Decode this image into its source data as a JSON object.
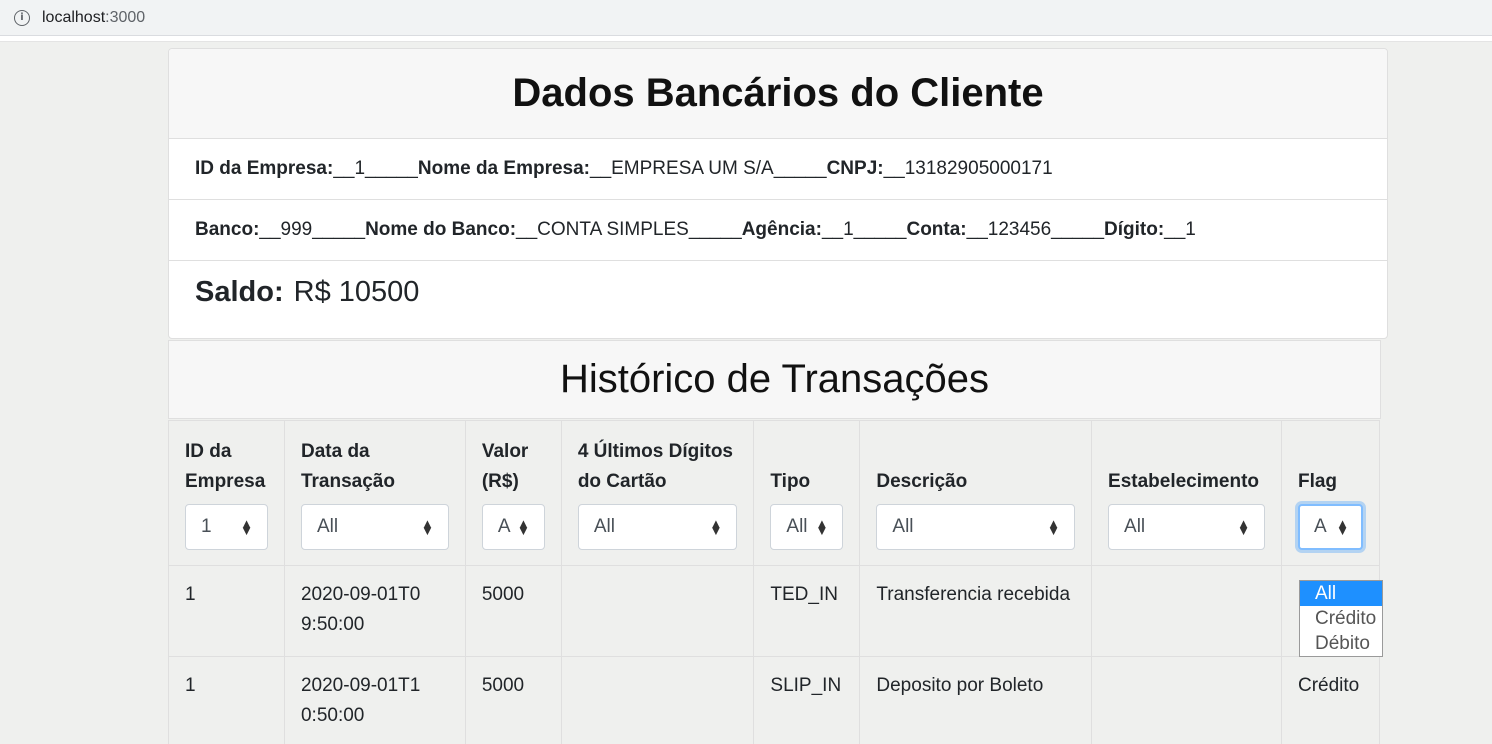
{
  "browser": {
    "host": "localhost",
    "port": ":3000"
  },
  "card": {
    "title": "Dados Bancários do Cliente",
    "row1": {
      "id_label": "ID da Empresa:",
      "id_value": "__1_____",
      "nome_label": "Nome da Empresa:",
      "nome_value": "__EMPRESA UM S/A_____",
      "cnpj_label": "CNPJ:",
      "cnpj_value": "__13182905000171"
    },
    "row2": {
      "banco_label": "Banco:",
      "banco_value": "__999_____",
      "nome_banco_label": "Nome do Banco:",
      "nome_banco_value": "__CONTA SIMPLES_____",
      "agencia_label": "Agência:",
      "agencia_value": "__1_____",
      "conta_label": "Conta:",
      "conta_value": "__123456_____",
      "digito_label": "Dígito:",
      "digito_value": "__1"
    },
    "saldo_label": "Saldo:",
    "saldo_value": "R$ 10500"
  },
  "history": {
    "title": "Histórico de Transações",
    "columns": [
      {
        "label": "ID da Empresa",
        "filter": "1"
      },
      {
        "label": "Data da Transação",
        "filter": "All"
      },
      {
        "label": "Valor (R$)",
        "filter": "A"
      },
      {
        "label": "4 Últimos Dígitos do Cartão",
        "filter": "All"
      },
      {
        "label": "Tipo",
        "filter": "All"
      },
      {
        "label": "Descrição",
        "filter": "All"
      },
      {
        "label": "Estabelecimento",
        "filter": "All"
      },
      {
        "label": "Flag",
        "filter": "A"
      }
    ],
    "rows": [
      [
        "1",
        "2020-09-01T09:50:00",
        "5000",
        "",
        "TED_IN",
        "Transferencia recebida",
        "",
        ""
      ],
      [
        "1",
        "2020-09-01T10:50:00",
        "5000",
        "",
        "SLIP_IN",
        "Deposito por Boleto",
        "",
        "Crédito"
      ]
    ],
    "flag_options": [
      "All",
      "Crédito",
      "Débito"
    ]
  },
  "colors": {
    "accent": "#1e90ff",
    "focus": "#80bdff"
  }
}
